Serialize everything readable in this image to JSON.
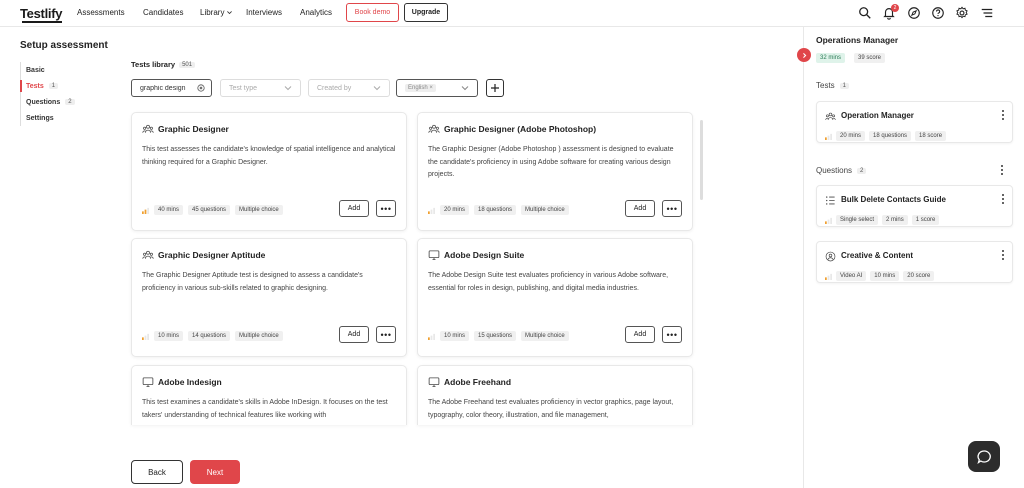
{
  "nav": {
    "logo": "Testlify",
    "items": [
      "Assessments",
      "Candidates",
      "Library",
      "Interviews",
      "Analytics"
    ],
    "book_demo": "Book demo",
    "upgrade": "Upgrade",
    "notification_count": "2",
    "icons": [
      "search-icon",
      "bell-icon",
      "compass-icon",
      "help-icon",
      "gear-icon",
      "menu-icon"
    ]
  },
  "setup": {
    "title": "Setup assessment",
    "steps": [
      {
        "label": "Basic",
        "count": ""
      },
      {
        "label": "Tests",
        "count": "1"
      },
      {
        "label": "Questions",
        "count": "2"
      },
      {
        "label": "Settings",
        "count": ""
      }
    ]
  },
  "library": {
    "title": "Tests library",
    "count": "501",
    "search_value": "graphic design",
    "filters": {
      "test_type": "Test type",
      "created_by": "Created by",
      "language_tag": "English ×"
    },
    "add_label": "Add",
    "cards": [
      {
        "title": "Graphic Designer",
        "desc": "This test assesses the candidate's knowledge of spatial intelligence and analytical thinking required for a Graphic Designer.",
        "duration": "40 mins",
        "questions": "45 questions",
        "type": "Multiple choice",
        "icon": "team-icon"
      },
      {
        "title": "Graphic Designer (Adobe Photoshop)",
        "desc": "The Graphic Designer (Adobe Photoshop ) assessment is designed to evaluate the candidate's proficiency in using Adobe software for creating various design projects.",
        "duration": "20 mins",
        "questions": "18 questions",
        "type": "Multiple choice",
        "icon": "team-icon"
      },
      {
        "title": "Graphic Designer Aptitude",
        "desc": "The Graphic Designer Aptitude test is designed to assess a candidate's proficiency in various sub-skills related to graphic designing.",
        "duration": "10 mins",
        "questions": "14 questions",
        "type": "Multiple choice",
        "icon": "team-icon"
      },
      {
        "title": "Adobe Design Suite",
        "desc": "The Adobe Design Suite test evaluates proficiency in various Adobe software, essential for roles in design, publishing, and digital media industries.",
        "duration": "10 mins",
        "questions": "15 questions",
        "type": "Multiple choice",
        "icon": "monitor-icon"
      },
      {
        "title": "Adobe Indesign",
        "desc": "This test examines a candidate's skills in Adobe InDesign. It focuses on the test takers' understanding of technical features like working with",
        "duration": "",
        "questions": "",
        "type": "",
        "icon": "monitor-icon"
      },
      {
        "title": "Adobe Freehand",
        "desc": "The Adobe Freehand test evaluates proficiency in vector graphics, page layout, typography, color theory, illustration, and file management,",
        "duration": "",
        "questions": "",
        "type": "",
        "icon": "monitor-icon"
      }
    ]
  },
  "footer": {
    "back": "Back",
    "next": "Next"
  },
  "right_panel": {
    "title": "Operations Manager",
    "duration": "32 mins",
    "score": "39 score",
    "tests_label": "Tests",
    "tests_count": "1",
    "questions_label": "Questions",
    "questions_count": "2",
    "tests": [
      {
        "title": "Operation Manager",
        "duration": "20 mins",
        "questions": "18 questions",
        "score": "18 score"
      }
    ],
    "questions": [
      {
        "title": "Bulk Delete Contacts Guide",
        "type": "Single select",
        "duration": "2 mins",
        "score": "1 score"
      },
      {
        "title": "Creative & Content",
        "type": "Video AI",
        "duration": "10 mins",
        "score": "20 score"
      }
    ]
  },
  "colors": {
    "accent": "#e0464a",
    "chip_green": "#dff3ea"
  }
}
